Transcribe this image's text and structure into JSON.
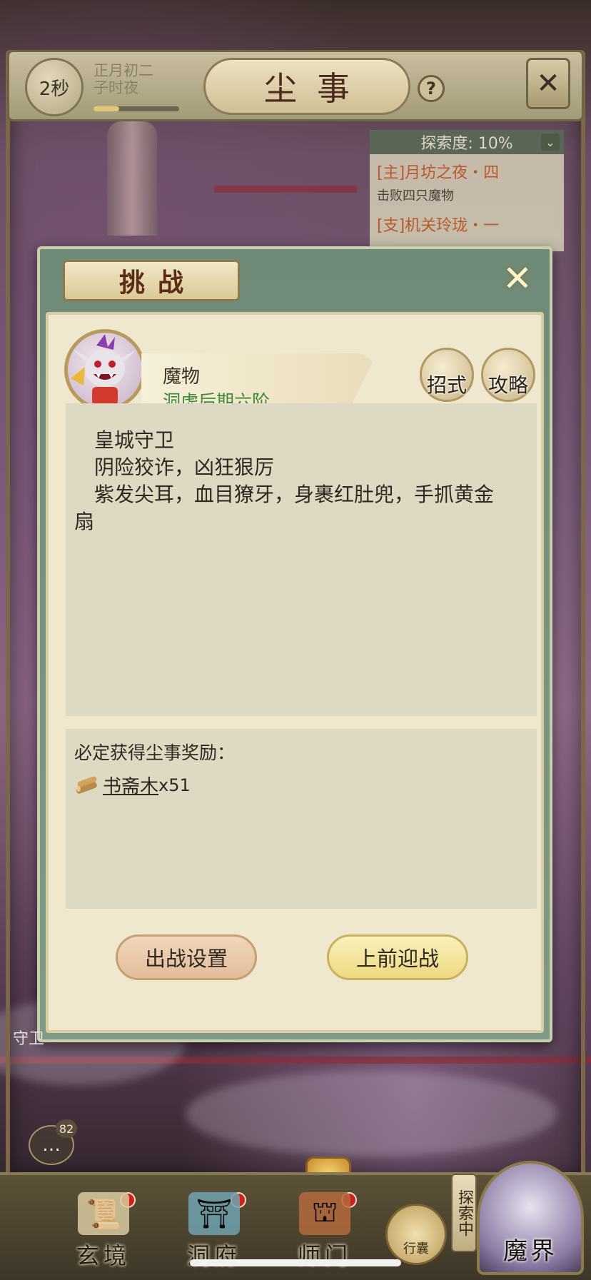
{
  "header": {
    "timer": "2秒",
    "date_line1": "正月初二",
    "date_line2": "子时夜",
    "time_progress": 0.3,
    "title": "尘事",
    "help_icon": "question-icon",
    "close_icon": "crossed-swords-close-icon"
  },
  "quest_panel": {
    "exploration": "探索度: 10%",
    "main_quest": "[主]月坊之夜・四",
    "main_quest_desc": "击败四只魔物",
    "side_quest": "[支]机关玲珑・一"
  },
  "dialog": {
    "title": "挑战",
    "monster": {
      "name": "魔物",
      "rank": "洞虚后期六阶"
    },
    "buttons": {
      "moves": "招式",
      "guide": "攻略"
    },
    "description": [
      "　皇城守卫",
      "　阴险狡诈，凶狂狠厉",
      "　紫发尖耳，血目獠牙，身裹红肚兜，手抓黄金",
      "扇"
    ],
    "reward": {
      "title": "必定获得尘事奖励：",
      "item_name": "书斋木",
      "item_qty": "x51"
    },
    "actions": {
      "settings": "出战设置",
      "fight": "上前迎战"
    }
  },
  "scene": {
    "guard_label": "守卫",
    "chat_count": "82"
  },
  "bottom_nav": {
    "items": [
      {
        "label": "玄境",
        "icon": "scroll-icon"
      },
      {
        "label": "洞府",
        "icon": "pavilion-icon"
      },
      {
        "label": "师门",
        "icon": "gate-icon"
      }
    ],
    "bag": "行囊",
    "explore_tag": "探索中",
    "demon_world": "魔界"
  },
  "colors": {
    "accent_green": "#3e8a38",
    "quest_orange": "#b7592b",
    "dialog_frame": "#6f8a78",
    "panel_bg": "#efe8cf"
  }
}
